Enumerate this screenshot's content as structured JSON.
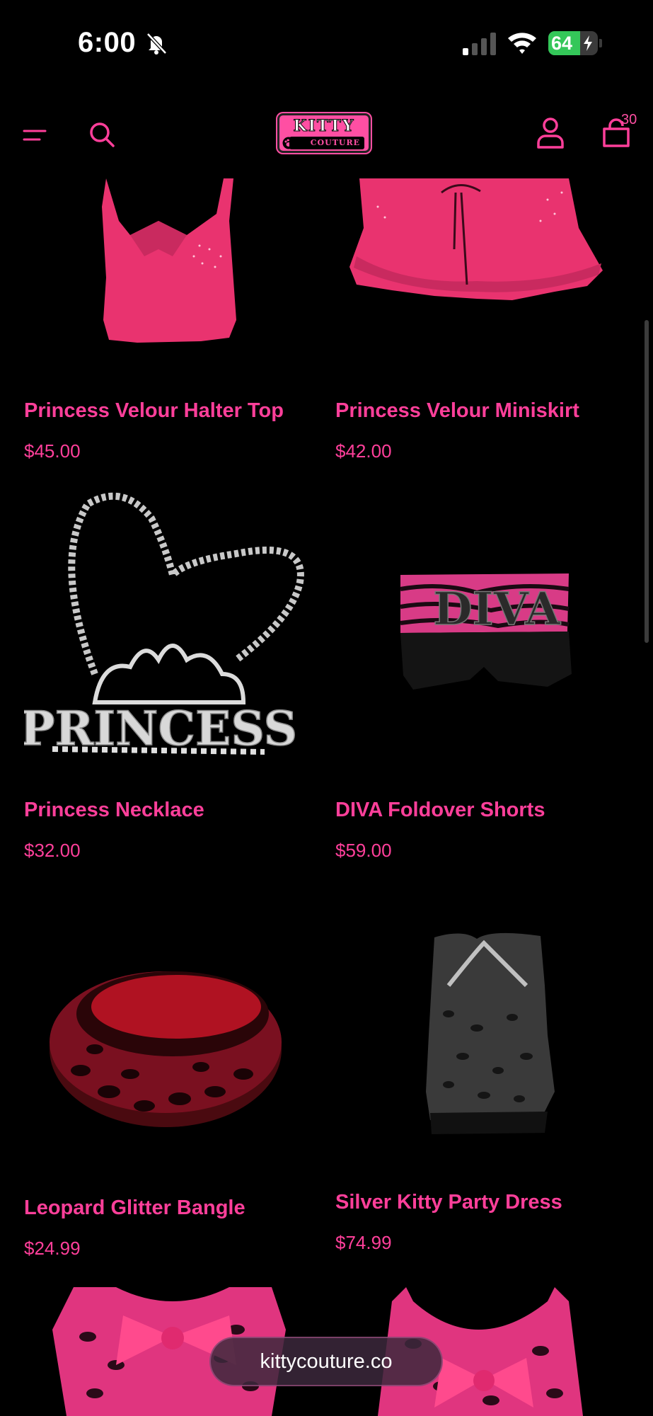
{
  "status_bar": {
    "time": "6:00",
    "battery_level": "64",
    "bell_icon": "bell-slash-icon",
    "signal_icon": "cellular-signal-icon",
    "wifi_icon": "wifi-icon"
  },
  "header": {
    "menu_icon": "hamburger-menu-icon",
    "search_icon": "search-icon",
    "logo_top": "KITTY",
    "logo_bottom": "COUTURE",
    "account_icon": "account-icon",
    "cart_icon": "cart-icon",
    "cart_count": "30"
  },
  "products": [
    {
      "name": "Princess Velour Halter Top",
      "price": "$45.00"
    },
    {
      "name": "Princess Velour Miniskirt",
      "price": "$42.00"
    },
    {
      "name": "Princess Necklace",
      "price": "$32.00"
    },
    {
      "name": "DIVA Foldover Shorts",
      "price": "$59.00"
    },
    {
      "name": "Leopard Glitter Bangle",
      "price": "$24.99"
    },
    {
      "name": "Silver Kitty Party Dress",
      "price": "$74.99"
    }
  ],
  "necklace_text": "PRINCESS",
  "shorts_text": "DIVA",
  "browser": {
    "url": "kittycouture.co"
  },
  "colors": {
    "accent": "#ff3f9a",
    "background": "#000000",
    "battery": "#34c759"
  }
}
